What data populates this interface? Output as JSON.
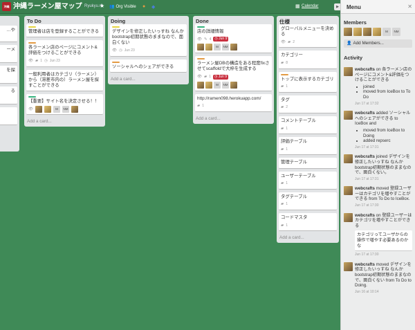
{
  "header": {
    "logo_text": "沖縄",
    "board_title": "沖縄ラーメン屋マップ",
    "org_name": "Ryukyu.rb",
    "star_icon": "star-icon",
    "visibility": "Org Visible",
    "calendar": "Calendar",
    "vote_icon": "vote-icon",
    "label_colors": [
      "#e39a42",
      "#4a7fd4"
    ]
  },
  "colors": {
    "background": "#3f8a57",
    "list": "#e2e4e6",
    "due_badge": "#c9303f"
  },
  "lists": {
    "partial": {
      "cards": [
        "…や",
        "ーメ",
        "を探",
        "る",
        ""
      ]
    },
    "todo": {
      "title": "To Do",
      "add_card": "Add a card...",
      "cards": [
        {
          "text": "管理者は店を登録することができる"
        },
        {
          "text": "各ラーメン店のページにコメント&評価をつけることができる",
          "badge_comments": "1",
          "due": "Jun 23"
        },
        {
          "text": "一般利用者はカテゴリ（ラーメン）から（滞差市内の）ラーメン屋を探すことができる"
        },
        {
          "text": "【重要】サイト名を決定させる！！",
          "members": [
            "M",
            "NM"
          ]
        }
      ]
    },
    "doing": {
      "title": "Doing",
      "add_card": "Add a card...",
      "cards": [
        {
          "text": "デザインを修正したいっすね なんかbootstrap初期状態のままなので、面白くない",
          "due": "Jun 23"
        },
        {
          "text": "ソーシャルへのシェアができる"
        }
      ]
    },
    "done": {
      "title": "Done",
      "add_card": "Add a card...",
      "cards": [
        {
          "text": "店の詳細情報",
          "badge_checklist": "4",
          "due": "Jun 9",
          "members": [
            "M",
            "NM"
          ]
        },
        {
          "text": "ラーメン屋DBの構造をある程度fixさせてscaffoldで大枠を生成する",
          "badge_comments": "1",
          "due": "Jun 9",
          "members": [
            "M",
            "NM"
          ]
        },
        {
          "text": "http://ramen098.herokuapp.com/",
          "badge_comments": "1"
        }
      ]
    },
    "spec": {
      "title": "仕様",
      "add_card": "Add a card...",
      "cards": [
        {
          "text": "グローバルメニューを決める",
          "badge": "2"
        },
        {
          "text": "カテゴリー",
          "badge": "8"
        },
        {
          "text": "トップに表示するカテゴリ",
          "badge": "1"
        },
        {
          "text": "タグ",
          "badge": "2"
        },
        {
          "text": "コメントテーブル",
          "badge": "1"
        },
        {
          "text": "評価テーブル",
          "badge": "1"
        },
        {
          "text": "管理テーブル"
        },
        {
          "text": "ユーザーテーブル",
          "badge": "1"
        },
        {
          "text": "タグテーブル",
          "badge": "1"
        },
        {
          "text": "コードマスタ",
          "badge": "1"
        }
      ]
    }
  },
  "sidebar": {
    "title": "Menu",
    "members_title": "Members",
    "members": [
      "M",
      "NM"
    ],
    "add_members": "Add Members...",
    "activity_title": "Activity",
    "activity": [
      {
        "user": "webcrafts",
        "text": "on 各ラーメン店のページにコメント&評価をつけることができる",
        "bullets": [
          "joined",
          "moved from IceBox to To Do"
        ],
        "time": "Jun 17 at 17:32"
      },
      {
        "user": "webcrafts",
        "text": "added ソーシャルへのシェアができる to IceBox and",
        "bullets": [
          "moved from IceBox to Doing",
          "added repserc"
        ],
        "time": "Jun 17 at 17:31"
      },
      {
        "user": "webcrafts",
        "text": "joined デザインを修正したいっすね なんか bootstrap初期状態のままなので、面白くない。",
        "time": "Jun 17 at 17:31"
      },
      {
        "user": "webcrafts",
        "text": "moved 登録ユーザーはカテゴリを増やすことができる from To Do to IceBox.",
        "time": "Jun 17 at 17:30"
      },
      {
        "user": "webcrafts",
        "text": "on 登録ユーザーはカテゴリを増やすことができる",
        "comment": "カテゴリってユーザからの操作で増やす必要あるのかな",
        "time": "Jun 17 at 17:30"
      },
      {
        "user": "webcrafts",
        "text": "moved デザインを修正したいっすね なんか bootstrap初期状態のままなので、面白くない from To Do to Doing.",
        "time": "Jun 16 at 10:14"
      }
    ]
  }
}
